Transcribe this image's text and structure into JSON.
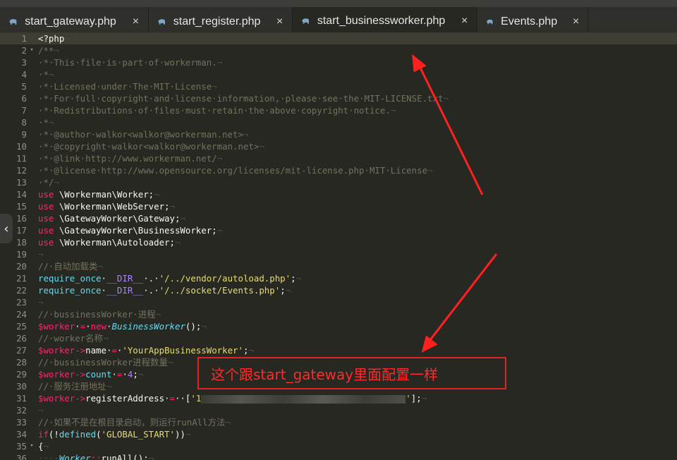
{
  "tabs": [
    {
      "label": "start_gateway.php",
      "active": false
    },
    {
      "label": "start_register.php",
      "active": false
    },
    {
      "label": "start_businessworker.php",
      "active": true
    },
    {
      "label": "Events.php",
      "active": false
    }
  ],
  "close_glyph": "×",
  "icon_name": "php-elephant-icon",
  "annotation": "这个跟start_gateway里面配置一样",
  "lines": [
    {
      "n": "1",
      "f": "",
      "t": [
        [
          "p",
          "<?php"
        ],
        [
          "ws",
          "¬"
        ]
      ]
    },
    {
      "n": "2",
      "f": "▾",
      "t": [
        [
          "c",
          "/**"
        ],
        [
          "ws",
          "¬"
        ]
      ]
    },
    {
      "n": "3",
      "f": "",
      "t": [
        [
          "c",
          "·*·This·file·is·part·of·workerman."
        ],
        [
          "ws",
          "¬"
        ]
      ]
    },
    {
      "n": "4",
      "f": "",
      "t": [
        [
          "c",
          "·*"
        ],
        [
          "ws",
          "¬"
        ]
      ]
    },
    {
      "n": "5",
      "f": "",
      "t": [
        [
          "c",
          "·*·Licensed·under·The·MIT·License"
        ],
        [
          "ws",
          "¬"
        ]
      ]
    },
    {
      "n": "6",
      "f": "",
      "t": [
        [
          "c",
          "·*·For·full·copyright·and·license·information,·please·see·the·MIT-LICENSE.txt"
        ],
        [
          "ws",
          "¬"
        ]
      ]
    },
    {
      "n": "7",
      "f": "",
      "t": [
        [
          "c",
          "·*·Redistributions·of·files·must·retain·the·above·copyright·notice."
        ],
        [
          "ws",
          "¬"
        ]
      ]
    },
    {
      "n": "8",
      "f": "",
      "t": [
        [
          "c",
          "·*"
        ],
        [
          "ws",
          "¬"
        ]
      ]
    },
    {
      "n": "9",
      "f": "",
      "t": [
        [
          "c",
          "·*·@author·walkor<walkor@workerman.net>"
        ],
        [
          "ws",
          "¬"
        ]
      ]
    },
    {
      "n": "10",
      "f": "",
      "t": [
        [
          "c",
          "·*·@copyright·walkor<walkor@workerman.net>"
        ],
        [
          "ws",
          "¬"
        ]
      ]
    },
    {
      "n": "11",
      "f": "",
      "t": [
        [
          "c",
          "·*·@link·http://www.workerman.net/"
        ],
        [
          "ws",
          "¬"
        ]
      ]
    },
    {
      "n": "12",
      "f": "",
      "t": [
        [
          "c",
          "·*·@license·http://www.opensource.org/licenses/mit-license.php·MIT·License"
        ],
        [
          "ws",
          "¬"
        ]
      ]
    },
    {
      "n": "13",
      "f": "",
      "t": [
        [
          "c",
          "·*/"
        ],
        [
          "ws",
          "¬"
        ]
      ]
    },
    {
      "n": "14",
      "f": "",
      "t": [
        [
          "k",
          "use"
        ],
        [
          "p",
          " \\Workerman\\Worker;"
        ],
        [
          "ws",
          "¬"
        ]
      ]
    },
    {
      "n": "15",
      "f": "",
      "t": [
        [
          "k",
          "use"
        ],
        [
          "p",
          " \\Workerman\\WebServer;"
        ],
        [
          "ws",
          "¬"
        ]
      ]
    },
    {
      "n": "16",
      "f": "",
      "t": [
        [
          "k",
          "use"
        ],
        [
          "p",
          " \\GatewayWorker\\Gateway;"
        ],
        [
          "ws",
          "¬"
        ]
      ]
    },
    {
      "n": "17",
      "f": "",
      "t": [
        [
          "k",
          "use"
        ],
        [
          "p",
          " \\GatewayWorker\\BusinessWorker;"
        ],
        [
          "ws",
          "¬"
        ]
      ]
    },
    {
      "n": "18",
      "f": "",
      "t": [
        [
          "k",
          "use"
        ],
        [
          "p",
          " \\Workerman\\Autoloader;"
        ],
        [
          "ws",
          "¬"
        ]
      ]
    },
    {
      "n": "19",
      "f": "",
      "t": [
        [
          "ws",
          "¬"
        ]
      ]
    },
    {
      "n": "20",
      "f": "",
      "t": [
        [
          "c",
          "//·自动加载类"
        ],
        [
          "ws",
          "¬"
        ]
      ]
    },
    {
      "n": "21",
      "f": "",
      "t": [
        [
          "bl",
          "require_once"
        ],
        [
          "p",
          "·"
        ],
        [
          "n",
          "__DIR__"
        ],
        [
          "p",
          "·.·"
        ],
        [
          "s",
          "'/../vendor/autoload.php'"
        ],
        [
          "p",
          ";"
        ],
        [
          "ws",
          "¬"
        ]
      ]
    },
    {
      "n": "22",
      "f": "",
      "t": [
        [
          "bl",
          "require_once"
        ],
        [
          "p",
          "·"
        ],
        [
          "n",
          "__DIR__"
        ],
        [
          "p",
          "·.·"
        ],
        [
          "s",
          "'/../socket/Events.php'"
        ],
        [
          "p",
          ";"
        ],
        [
          "ws",
          "¬"
        ]
      ]
    },
    {
      "n": "23",
      "f": "",
      "t": [
        [
          "ws",
          "¬"
        ]
      ]
    },
    {
      "n": "24",
      "f": "",
      "t": [
        [
          "c",
          "//·bussinessWorker·进程"
        ],
        [
          "ws",
          "¬"
        ]
      ]
    },
    {
      "n": "25",
      "f": "",
      "t": [
        [
          "v",
          "$worker"
        ],
        [
          "p",
          "·"
        ],
        [
          "o",
          "="
        ],
        [
          "p",
          "·"
        ],
        [
          "k",
          "new"
        ],
        [
          "p",
          "·"
        ],
        [
          "cls",
          "BusinessWorker"
        ],
        [
          "p",
          "();"
        ],
        [
          "ws",
          "¬"
        ]
      ]
    },
    {
      "n": "26",
      "f": "",
      "t": [
        [
          "c",
          "//·worker名称"
        ],
        [
          "ws",
          "¬"
        ]
      ]
    },
    {
      "n": "27",
      "f": "",
      "t": [
        [
          "v",
          "$worker"
        ],
        [
          "o",
          "->"
        ],
        [
          "p",
          "name·"
        ],
        [
          "o",
          "="
        ],
        [
          "p",
          "·"
        ],
        [
          "s",
          "'YourAppBusinessWorker'"
        ],
        [
          "p",
          ";"
        ],
        [
          "ws",
          "¬"
        ]
      ]
    },
    {
      "n": "28",
      "f": "",
      "t": [
        [
          "c",
          "//·bussinessWorker进程数量"
        ],
        [
          "ws",
          "¬"
        ]
      ]
    },
    {
      "n": "29",
      "f": "",
      "t": [
        [
          "v",
          "$worker"
        ],
        [
          "o",
          "->"
        ],
        [
          "bl",
          "count"
        ],
        [
          "p",
          "·"
        ],
        [
          "o",
          "="
        ],
        [
          "p",
          "·"
        ],
        [
          "n",
          "4"
        ],
        [
          "p",
          ";"
        ],
        [
          "ws",
          "¬"
        ]
      ]
    },
    {
      "n": "30",
      "f": "",
      "t": [
        [
          "c",
          "//·服务注册地址"
        ],
        [
          "ws",
          "¬"
        ]
      ]
    },
    {
      "n": "31",
      "f": "",
      "t": [
        [
          "v",
          "$worker"
        ],
        [
          "o",
          "->"
        ],
        [
          "p",
          "registerAddress·"
        ],
        [
          "o",
          "="
        ],
        [
          "p",
          "··["
        ],
        [
          "s",
          "'1"
        ],
        [
          "blur",
          ""
        ],
        [
          "s",
          "'"
        ],
        [
          "p",
          "];"
        ],
        [
          "ws",
          "¬"
        ]
      ]
    },
    {
      "n": "32",
      "f": "",
      "t": [
        [
          "ws",
          "¬"
        ]
      ]
    },
    {
      "n": "33",
      "f": "",
      "t": [
        [
          "c",
          "//·如果不是在根目录启动，则运行runAll方法"
        ],
        [
          "ws",
          "¬"
        ]
      ]
    },
    {
      "n": "34",
      "f": "",
      "t": [
        [
          "k",
          "if"
        ],
        [
          "p",
          "(!"
        ],
        [
          "bl",
          "defined"
        ],
        [
          "p",
          "("
        ],
        [
          "s",
          "'GLOBAL_START'"
        ],
        [
          "p",
          "))"
        ],
        [
          "ws",
          "¬"
        ]
      ]
    },
    {
      "n": "35",
      "f": "▾",
      "t": [
        [
          "p",
          "{"
        ],
        [
          "ws",
          "¬"
        ]
      ]
    },
    {
      "n": "36",
      "f": "",
      "t": [
        [
          "ws",
          "····"
        ],
        [
          "cls",
          "Worker"
        ],
        [
          "o",
          "::"
        ],
        [
          "p",
          "runAll();"
        ],
        [
          "ws",
          "¬"
        ]
      ]
    }
  ]
}
